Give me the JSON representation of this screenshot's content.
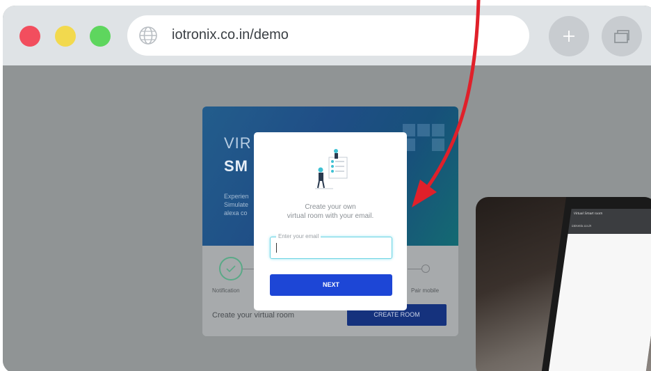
{
  "browser": {
    "url": "iotronix.co.in/demo",
    "buttons": {
      "new_tab": "new-tab",
      "tabs": "tabs"
    }
  },
  "card": {
    "hero_title_line1": "VIR",
    "hero_title_line2": "SM",
    "hero_desc": [
      "Experien",
      "Simulate",
      "alexa co"
    ],
    "step_left_label": "Notification",
    "step_right_label": "Pair mobile",
    "footer_text": "Create your virtual room",
    "create_button": "CREATE ROOM"
  },
  "modal": {
    "line1": "Create your own",
    "line2": "virtual room with your email.",
    "email_label": "Enter your email",
    "email_value": "",
    "next_button": "NEXT"
  },
  "inset": {
    "tab_title": "Virtual Smart room",
    "url": "iotronix.co.in"
  },
  "colors": {
    "arrow": "#e0202a",
    "next_button": "#1d46d6",
    "create_button": "#15327d",
    "input_focus": "#6ad3e3"
  }
}
